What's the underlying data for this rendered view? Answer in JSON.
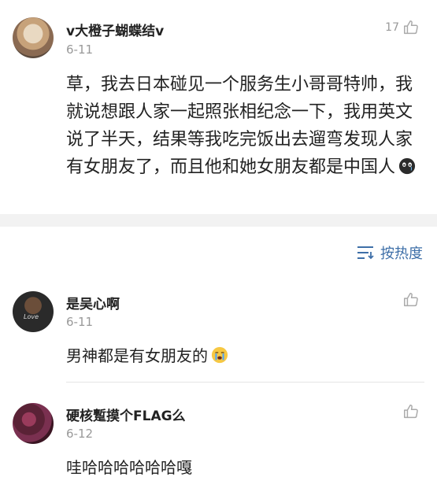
{
  "main_comment": {
    "username": "v大橙子蝴蝶结v",
    "date": "6-11",
    "like_count": "17",
    "text": "草，我去日本碰见一个服务生小哥哥特帅，我就说想跟人家一起照张相纪念一下，我用英文说了半天，结果等我吃完饭出去遛弯发现人家有女朋友了，而且他和她女朋友都是中国人",
    "emoji": "crying-face-emoji"
  },
  "sort": {
    "label": "按热度",
    "icon": "sort-icon"
  },
  "replies": [
    {
      "username": "是吴心啊",
      "date": "6-11",
      "text": "男神都是有女朋友的",
      "emoji": "sobbing-face-emoji",
      "avatar_text": "Love"
    },
    {
      "username": "硬核蹔摸个FLAG么",
      "date": "6-12",
      "text": "哇哈哈哈哈哈哈嘎"
    }
  ],
  "colors": {
    "accent_blue": "#3e6fa8",
    "muted": "#999999",
    "divider": "#f2f2f2"
  }
}
